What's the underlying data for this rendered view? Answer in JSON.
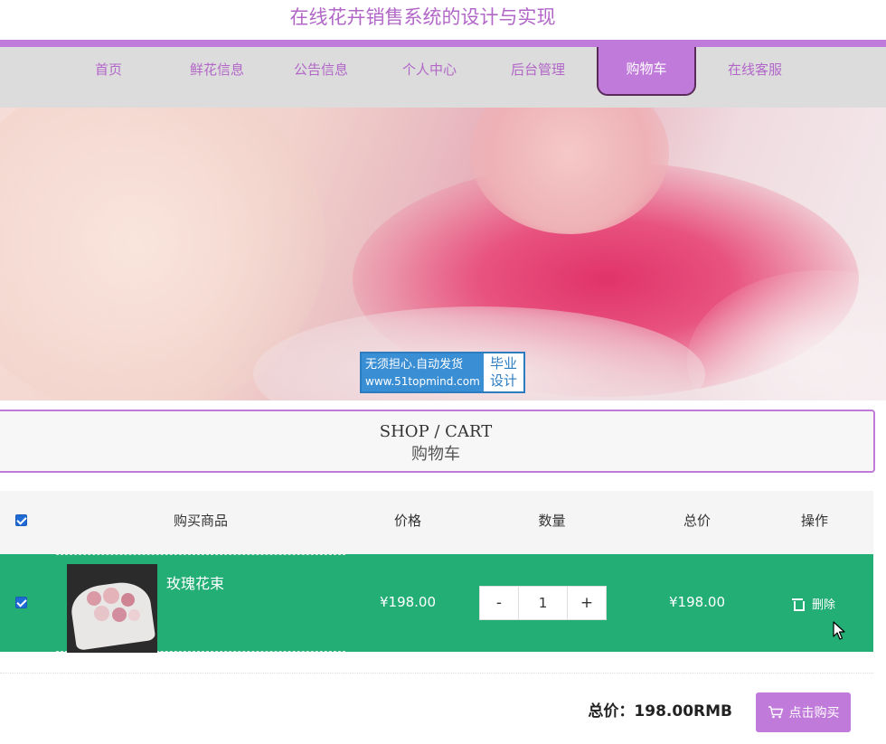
{
  "header": {
    "title": "在线花卉销售系统的设计与实现"
  },
  "nav": {
    "items": [
      {
        "label": "首页"
      },
      {
        "label": "鲜花信息"
      },
      {
        "label": "公告信息"
      },
      {
        "label": "个人中心"
      },
      {
        "label": "后台管理"
      },
      {
        "label": "购物车",
        "active": true
      },
      {
        "label": "在线客服"
      }
    ]
  },
  "watermark": {
    "line1": "无须担心.自动发货",
    "line2": "www.51topmind.com",
    "tag1": "毕业",
    "tag2": "设计"
  },
  "cart_heading": {
    "en": "SHOP / CART",
    "cn": "购物车"
  },
  "table": {
    "headers": {
      "product": "购买商品",
      "price": "价格",
      "quantity": "数量",
      "subtotal": "总价",
      "action": "操作"
    },
    "select_all_checked": true,
    "rows": [
      {
        "checked": true,
        "name": "玫瑰花束",
        "price": "¥198.00",
        "quantity": "1",
        "subtotal": "¥198.00",
        "delete_label": "删除",
        "decrement": "-",
        "increment": "+"
      }
    ]
  },
  "footer": {
    "total": "总价：198.00RMB",
    "buy_label": "点击购买"
  },
  "colors": {
    "accent": "#c07ad9",
    "nav_text": "#b267c8",
    "row_selected": "#23ae76",
    "nav_bg": "#dcdcdc"
  },
  "icons": {
    "trash": "trash-icon",
    "cart": "shopping-cart-icon",
    "cursor": "mouse-pointer-icon"
  }
}
